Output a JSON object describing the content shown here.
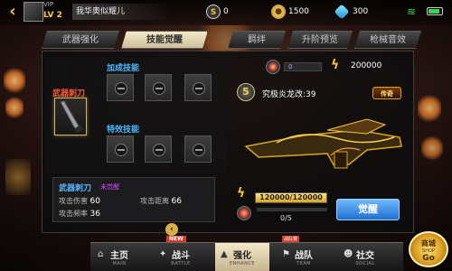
{
  "top_bar": {
    "vip": "VIP",
    "level": "LV 2",
    "player_name": "我华奥似耀儿",
    "s_count": "0",
    "gold": "1500",
    "gems": "300",
    "s_icon": "S"
  },
  "tabs": [
    {
      "label": "武器强化",
      "active": false
    },
    {
      "label": "技能觉醒",
      "active": true
    },
    {
      "label": "羁绊",
      "active": false
    },
    {
      "label": "升阶预览",
      "active": false
    },
    {
      "label": "枪械音效",
      "active": false
    }
  ],
  "left": {
    "section_add": "加成技能",
    "section_special": "特效技能",
    "weapon_label": "武器刺刀"
  },
  "info": {
    "name": "武器刺刀",
    "state": "未觉醒",
    "attack_damage_label": "攻击伤害",
    "attack_damage": "60",
    "attack_range_label": "攻击距离",
    "attack_range": "66",
    "attack_rate_label": "攻击频率",
    "attack_rate": "36"
  },
  "right": {
    "cost_count": "0",
    "cost_value": "200000",
    "stage": "5",
    "skill_name": "究极炎龙改:39",
    "legend_tag": "传奇",
    "energy": "120000/120000",
    "energy_fraction": 1.0,
    "progress": "0/5",
    "progress_fraction": 0,
    "awaken_label": "觉醒"
  },
  "bottom_nav": [
    {
      "label": "主页",
      "sub": "MAIN",
      "icon": "home-icon",
      "glyph": "⌂",
      "active": false
    },
    {
      "label": "战斗",
      "sub": "BATTLE",
      "icon": "battle-icon",
      "glyph": "✦",
      "active": false,
      "badge": "NEW"
    },
    {
      "label": "强化",
      "sub": "ENHANCE",
      "icon": "enhance-icon",
      "glyph": "▲",
      "active": true
    },
    {
      "label": "战队",
      "sub": "TEAM",
      "icon": "team-icon",
      "glyph": "⚑",
      "active": false,
      "badge": "战队赛"
    },
    {
      "label": "社交",
      "sub": "SOCIAL",
      "icon": "social-icon",
      "glyph": "☻",
      "active": false
    }
  ],
  "shop": {
    "label": "商城",
    "sub": "SHOP",
    "go": "Go"
  },
  "colors": {
    "accent_gold": "#f0c540",
    "accent_blue": "#4fb7ff",
    "weapon_red": "#ff5a3a",
    "state_purple": "#d84bff",
    "button_blue": "#1f6fd1"
  }
}
